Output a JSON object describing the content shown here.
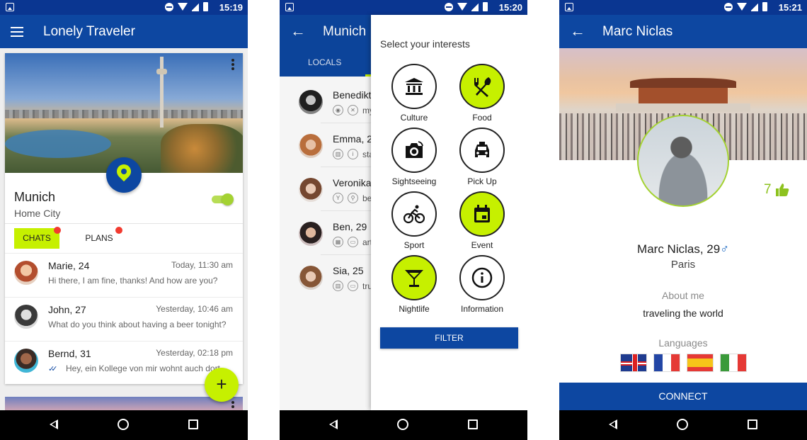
{
  "status": {
    "phone1_time": "15:19",
    "phone2_time": "15:20",
    "phone3_time": "15:21"
  },
  "phone1": {
    "title": "Lonely Traveler",
    "city": "Munich",
    "city_sub": "Home City",
    "home_city_toggle_on": true,
    "tabs": {
      "chats": "CHATS",
      "plans": "PLANS"
    },
    "chats": [
      {
        "name": "Marie, 24",
        "time": "Today, 11:30 am",
        "message": "Hi there, I am fine, thanks! And how are you?"
      },
      {
        "name": "John, 27",
        "time": "Yesterday, 10:46 am",
        "message": "What do you think about having a beer tonight?"
      },
      {
        "name": "Bernd, 31",
        "time": "Yesterday, 02:18 pm",
        "message": "Hey, ein Kollege von mir wohnt auch dort"
      }
    ],
    "fab": "+"
  },
  "phone2": {
    "title": "Munich",
    "tab_locals": "LOCALS",
    "locals": [
      {
        "name": "Benedikt, 2",
        "snippet": "my"
      },
      {
        "name": "Emma, 2",
        "snippet": "sta"
      },
      {
        "name": "Veronika,",
        "snippet": "be"
      },
      {
        "name": "Ben, 29",
        "snippet": "art"
      },
      {
        "name": "Sia, 25",
        "snippet": "tru"
      }
    ],
    "drawer_title": "Select your interests",
    "interests": [
      {
        "label": "Culture",
        "icon": "museum-icon",
        "selected": false
      },
      {
        "label": "Food",
        "icon": "fork-spoon-icon",
        "selected": true
      },
      {
        "label": "Sightseeing",
        "icon": "camera-icon",
        "selected": false
      },
      {
        "label": "Pick Up",
        "icon": "taxi-icon",
        "selected": false
      },
      {
        "label": "Sport",
        "icon": "bicycle-icon",
        "selected": false
      },
      {
        "label": "Event",
        "icon": "calendar-icon",
        "selected": true
      },
      {
        "label": "Nightlife",
        "icon": "cocktail-icon",
        "selected": true
      },
      {
        "label": "Information",
        "icon": "info-icon",
        "selected": false
      }
    ],
    "filter_button": "FILTER"
  },
  "phone3": {
    "title": "Marc Niclas",
    "likes": "7",
    "name_age": "Marc Niclas, 29",
    "gender_symbol": "♂",
    "city": "Paris",
    "about_label": "About me",
    "about_text": "traveling the world",
    "languages_label": "Languages",
    "languages": [
      "English",
      "French",
      "Spanish",
      "Italian"
    ],
    "connect_button": "CONNECT"
  },
  "colors": {
    "primary": "#0d47a1",
    "status_bar": "#0a3691",
    "accent_lime": "#c6f000",
    "badge_red": "#f23b30"
  }
}
